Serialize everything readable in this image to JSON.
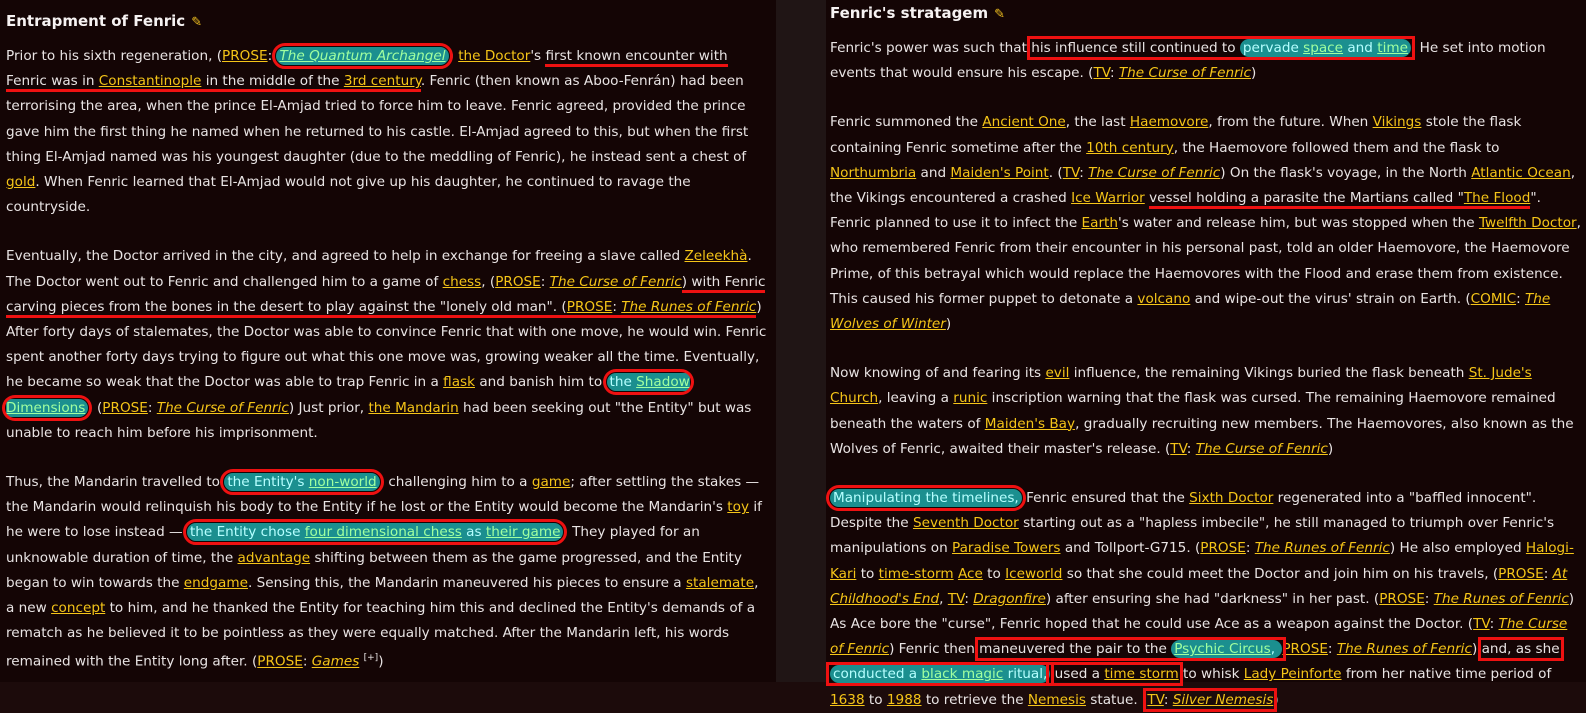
{
  "left": {
    "heading": "Entrapment of Fenric",
    "p1": {
      "a": "Prior to his sixth regeneration, (",
      "prose": "PROSE",
      "sep": ": ",
      "qa": "The Quantum Archangel",
      "b": ") ",
      "doctor": "the Doctor",
      "c": "'s ",
      "first": "first known encounter with Fenric was in ",
      "constantinople": "Constantinople",
      "d": " in the middle of the ",
      "century": "3rd century",
      "e": ". Fenric (then known as Aboo-Fenrán) had been terrorising the area, when the prince El-Amjad tried to force him to leave. Fenric agreed, provided the prince gave him the first thing he named when he returned to his castle. El-Amjad agreed to this, but when the first thing El-Amjad named was his youngest daughter (due to the meddling of Fenric), he instead sent a chest of ",
      "gold": "gold",
      "f": ". When Fenric learned that El-Amjad would not give up his daughter, he continued to ravage the countryside."
    },
    "p2": {
      "a": "Eventually, the Doctor arrived in the city, and agreed to help in exchange for freeing a slave called ",
      "zeleekha": "Zeleekhà",
      "b": ". The Doctor went out to Fenric and challenged him to a game of ",
      "chess": "chess",
      "c": ", (",
      "prose1": "PROSE",
      "sep": ": ",
      "curse1": "The Curse of Fenric",
      "d": ") with Fenric carving pieces from the bones in the desert to play against the \"lonely old man\". (",
      "prose2": "PROSE",
      "runes": "The Runes of Fenric",
      "e": ") After forty days of stalemates, the Doctor was able to convince Fenric that with one move, he would win. Fenric spent another forty days trying to figure out what this one move was, growing weaker all the time. Eventually, he became so weak that the Doctor was able to trap Fenric in a ",
      "flask": "flask",
      "f": " and banish him to ",
      "the": "the ",
      "shadow": "Shadow Dimensions",
      "g": ". (",
      "prose3": "PROSE",
      "curse2": "The Curse of Fenric",
      "h": ") Just prior, ",
      "mandarin": "the Mandarin",
      "i": " had been seeking out \"the Entity\" but was unable to reach him before his imprisonment."
    },
    "p3": {
      "a": "Thus, the Mandarin travelled to ",
      "entitys": "the Entity's ",
      "nonworld": "non-world",
      "b": ", challenging him to a ",
      "game": "game",
      "c": "; after settling the stakes — the Mandarin would relinquish his body to the Entity if he lost or the Entity would become the Mandarin's ",
      "toy": "toy",
      "d": " if he were to lose instead — ",
      "chose": "the Entity chose ",
      "fdc": "four dimensional chess",
      "as": " as ",
      "theirgame": "their game",
      "e": ". They played for an unknowable duration of time, the ",
      "advantage": "advantage",
      "f": " shifting between them as the game progressed, and the Entity began to win towards the ",
      "endgame": "endgame",
      "g": ". Sensing this, the Mandarin maneuvered his pieces to ensure a ",
      "stalemate": "stalemate",
      "h": ", a new ",
      "concept": "concept",
      "i": " to him, and he thanked the Entity for teaching him this and declined the Entity's demands of a rematch as he believed it to be pointless as they were equally matched. After the Mandarin left, his words remained with the Entity long after. (",
      "prose": "PROSE",
      "sep": ": ",
      "games": "Games",
      "sup": "[+]",
      "j": ")"
    }
  },
  "right": {
    "heading": "Fenric's stratagem",
    "p1": {
      "a": "Fenric's power was such that ",
      "influence": "his influence still continued to ",
      "pervade": "pervade ",
      "space": "space",
      "and": " and ",
      "time": "time",
      "b": ". He set into motion events that would ensure his escape. (",
      "tv": "TV",
      "sep": ": ",
      "curse": "The Curse of Fenric",
      "c": ")"
    },
    "p2": {
      "a": "Fenric summoned the ",
      "ancient": "Ancient One",
      "b": ", the last ",
      "haemovore": "Haemovore",
      "c": ", from the future. When ",
      "vikings": "Vikings",
      "d": " stole the flask containing Fenric sometime after the ",
      "tenth": "10th century",
      "e": ", the Haemovore followed them and the flask to ",
      "northumbria": "Northumbria",
      "f": " and ",
      "maidenspoint": "Maiden's Point",
      "g": ". (",
      "tv1": "TV",
      "curse1": "The Curse of Fenric",
      "h": ") On the flask's voyage, in the North ",
      "atlantic": "Atlantic Ocean",
      "i": ", the Vikings encountered a crashed ",
      "icewarrior": "Ice Warrior",
      "j": " ",
      "vessel": "vessel holding a parasite the Martians called \"",
      "flood": "The Flood",
      "k": "\". Fenric planned to use it to infect the ",
      "earth": "Earth",
      "l": "'s water and release him, but was stopped when the ",
      "twelfth": "Twelfth Doctor",
      "m": ", who remembered Fenric from their encounter in his personal past, told an older Haemovore, the Haemovore Prime, of this betrayal which would replace the Haemovores with the Flood and erase them from existence. This caused his former puppet to detonate a ",
      "volcano": "volcano",
      "n": " and wipe-out the virus' strain on Earth. (",
      "comic": "COMIC",
      "wolves": "The Wolves of Winter",
      "o": ")"
    },
    "p3": {
      "a": "Now knowing of and fearing its ",
      "evil": "evil",
      "b": " influence, the remaining Vikings buried the flask beneath ",
      "stjude": "St. Jude's Church",
      "c": ", leaving a ",
      "runic": "runic",
      "d": " inscription warning that the flask was cursed. The remaining Haemovore remained beneath the waters of ",
      "maidensbay": "Maiden's Bay",
      "e": ", gradually recruiting new members. The Haemovores, also known as the Wolves of Fenric, awaited their master's release. (",
      "tv": "TV",
      "curse": "The Curse of Fenric",
      "f": ")"
    },
    "p4": {
      "manip": "Manipulating the timelines,",
      "a": " Fenric ensured that the ",
      "sixth": "Sixth Doctor",
      "b": " regenerated into a \"baffled innocent\". Despite the ",
      "seventh": "Seventh Doctor",
      "c": " starting out as a \"hapless imbecile\", he still managed to triumph over Fenric's manipulations on ",
      "paradise": "Paradise Towers",
      "d": " and Tollport-G715. (",
      "prose1": "PROSE",
      "runes1": "The Runes of Fenric",
      "e": ") He also employed ",
      "halogi": "Halogi-Kari",
      "f": " to ",
      "timestorm1": "time-storm",
      "g": " ",
      "ace": "Ace",
      "h": " to ",
      "iceworld": "Iceworld",
      "i": " so that she could meet the Doctor and join him on his travels, (",
      "prose2": "PROSE",
      "childhood": "At Childhood's End",
      "j": ", ",
      "tv1": "TV",
      "dragonfire": "Dragonfire",
      "k": ") after ensuring she had \"darkness\" in her past. (",
      "prose3": "PROSE",
      "runes2": "The Runes of Fenric",
      "l": ") As Ace bore the \"curse\", Fenric hoped that he could use Ace as a weapon against the Doctor. (",
      "tv2": "TV",
      "curse": "The Curse of Fenric",
      "m": ") Fenric then ",
      "maneuvered": "maneuvered the pair to the ",
      "psychic": "Psychic Circus",
      "n": ", ",
      "prose4": "PROSE",
      "runes3": "The Runes of Fenric",
      "o": ") ",
      "andas": "and, as she ",
      "conducted": "conducted a ",
      "blackmagic": "black magic",
      "ritual": " ritual,",
      "p": " used a ",
      "timestorm2": "time storm",
      "q": " to whisk ",
      "peinforte": "Lady Peinforte",
      "r": " from her native time period of ",
      "y1638": "1638",
      "s": " to ",
      "y1988": "1988",
      "t": " to retrieve the ",
      "nemesis": "Nemesis",
      "u": " statue. (",
      "tv3": "TV",
      "silver": "Silver Nemesis",
      "v": ")"
    }
  }
}
